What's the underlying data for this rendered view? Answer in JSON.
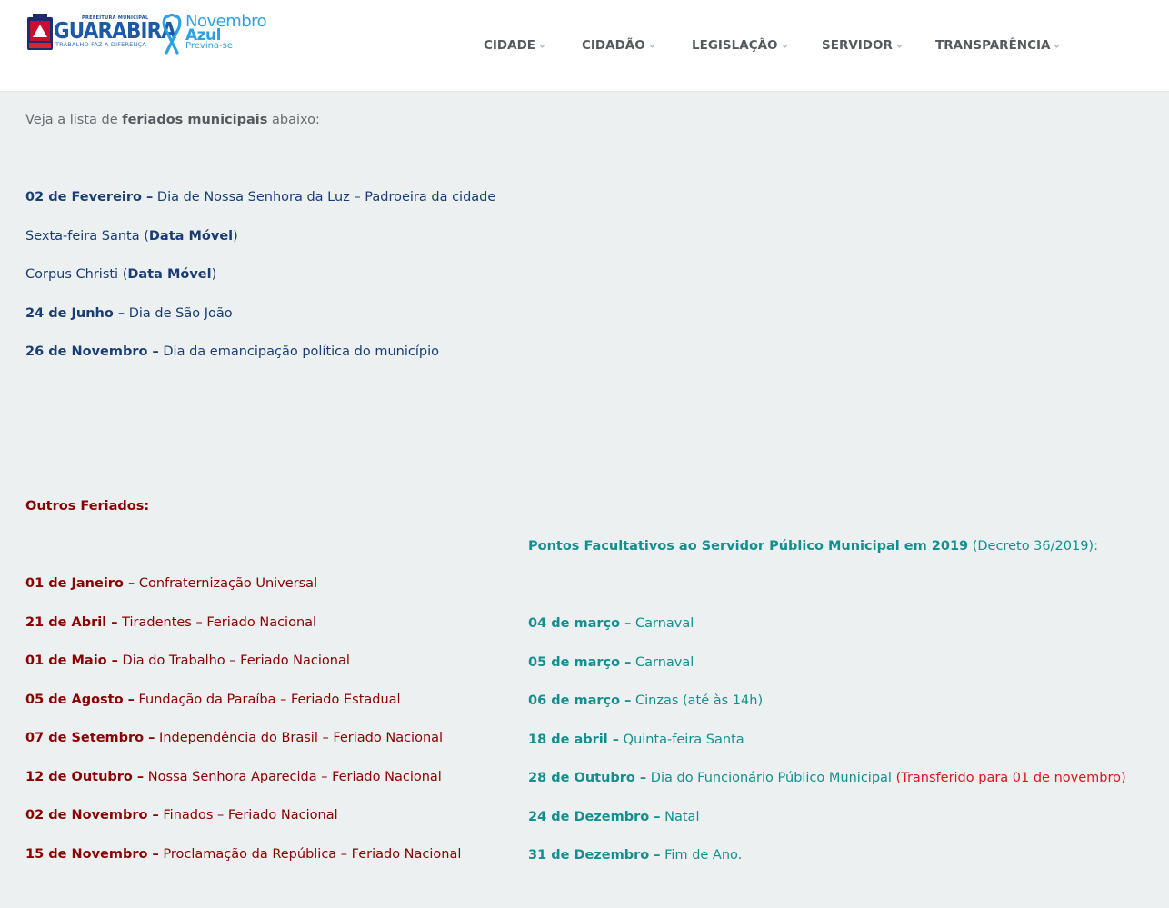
{
  "colors": {
    "background": "#ecf0f1",
    "header_bg": "#ffffff",
    "municipal_blue": "#1a3d73",
    "other_red": "#8b0000",
    "facultativo_teal": "#138f8f",
    "highlight_red": "#e2131a",
    "logo_blue": "#1c5aa8",
    "ribbon_blue": "#2aa1e3"
  },
  "header": {
    "logo": {
      "top_text": "PREFEITURA MUNICIPAL",
      "name": "GUARABIRA",
      "tagline": "TRABALHO FAZ A DIFERENÇA",
      "campaign_line1": "Novembro",
      "campaign_line2": "Azul",
      "campaign_line3": "Previna-se"
    },
    "nav": [
      {
        "label": "CIDADE"
      },
      {
        "label": "CIDADÃO"
      },
      {
        "label": "LEGISLAÇÃO"
      },
      {
        "label": "SERVIDOR"
      },
      {
        "label": "TRANSPARÊNCIA"
      }
    ]
  },
  "intro": {
    "before": "Veja a lista de ",
    "bold": "feriados municipais",
    "after": " abaixo:"
  },
  "municipal": [
    {
      "date": "02 de Fevereiro –",
      "desc": " Dia de Nossa Senhora da Luz – Padroeira da cidade"
    },
    {
      "before": "Sexta-feira Santa (",
      "bold": "Data Móvel",
      "after": ")"
    },
    {
      "before": "Corpus Christi (",
      "bold": "Data Móvel",
      "after": ")"
    },
    {
      "date": "24 de Junho –",
      "desc": " Dia de São João"
    },
    {
      "date": "26 de Novembro –",
      "desc": " Dia da emancipação política do município"
    }
  ],
  "outros": {
    "heading": "Outros Feriados:",
    "items": [
      {
        "date": "01 de Janeiro –",
        "desc": " Confraternização Universal"
      },
      {
        "date": "21 de Abril –",
        "desc": " Tiradentes – Feriado Nacional"
      },
      {
        "date": "01 de Maio –",
        "desc": " Dia do Trabalho – Feriado Nacional"
      },
      {
        "date": "05 de Agosto –",
        "desc": " Fundação da Paraíba – Feriado Estadual"
      },
      {
        "date": "07 de Setembro –",
        "desc": " Independência do Brasil – Feriado Nacional"
      },
      {
        "date": "12 de Outubro –",
        "desc": " Nossa Senhora Aparecida – Feriado Nacional"
      },
      {
        "date": "02 de Novembro –",
        "desc": " Finados – Feriado Nacional"
      },
      {
        "date": "15 de Novembro –",
        "desc": " Proclamação da República – Feriado Nacional"
      }
    ]
  },
  "pontos": {
    "heading": "Pontos Facultativos ao Servidor Público Municipal em 2019",
    "decree": " (Decreto 36/2019):",
    "items": [
      {
        "date": "04 de março –",
        "desc": " Carnaval"
      },
      {
        "date": "05 de março –",
        "desc": " Carnaval"
      },
      {
        "date": "06 de março –",
        "desc": " Cinzas (até às 14h)"
      },
      {
        "date": "18 de abril –",
        "desc": " Quinta-feira Santa"
      },
      {
        "date": "28 de Outubro –",
        "desc": " Dia do Funcionário Público Municipal ",
        "note": "(Transferido para 01 de novembro)"
      },
      {
        "date": "24 de Dezembro –",
        "desc": " Natal"
      },
      {
        "date": "31 de Dezembro –",
        "desc": " Fim de Ano."
      }
    ]
  }
}
